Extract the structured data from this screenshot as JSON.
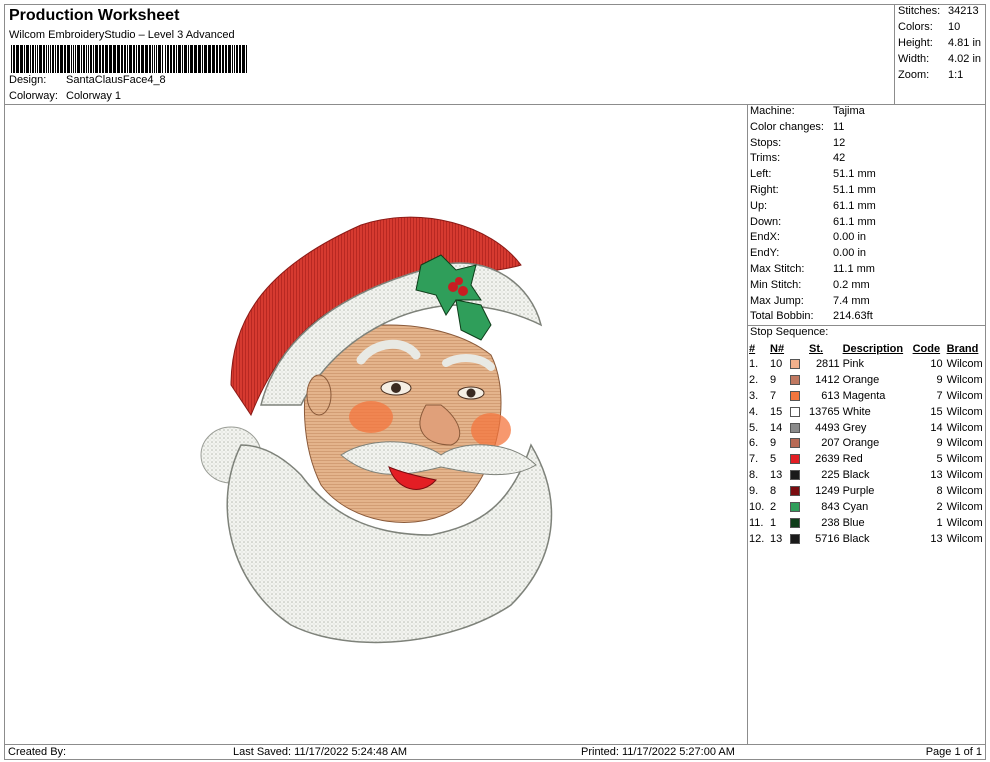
{
  "header": {
    "title": "Production Worksheet",
    "subtitle": "Wilcom EmbroideryStudio – Level 3 Advanced",
    "design_label": "Design:",
    "design_value": "SantaClausFace4_8",
    "colorway_label": "Colorway:",
    "colorway_value": "Colorway 1"
  },
  "stats": [
    {
      "label": "Stitches:",
      "value": "34213"
    },
    {
      "label": "Colors:",
      "value": "10"
    },
    {
      "label": "Height:",
      "value": "4.81 in"
    },
    {
      "label": "Width:",
      "value": "4.02 in"
    },
    {
      "label": "Zoom:",
      "value": "1:1"
    }
  ],
  "machine_info": [
    {
      "label": "Machine:",
      "value": "Tajima"
    },
    {
      "label": "Color changes:",
      "value": "11"
    },
    {
      "label": "Stops:",
      "value": "12"
    },
    {
      "label": "Trims:",
      "value": "42"
    },
    {
      "label": "Left:",
      "value": "51.1 mm"
    },
    {
      "label": "Right:",
      "value": "51.1 mm"
    },
    {
      "label": "Up:",
      "value": "61.1 mm"
    },
    {
      "label": "Down:",
      "value": "61.1 mm"
    },
    {
      "label": "EndX:",
      "value": "0.00 in"
    },
    {
      "label": "EndY:",
      "value": "0.00 in"
    },
    {
      "label": "Max Stitch:",
      "value": "11.1 mm"
    },
    {
      "label": "Min Stitch:",
      "value": "0.2 mm"
    },
    {
      "label": "Max Jump:",
      "value": "7.4 mm"
    },
    {
      "label": "Total Bobbin:",
      "value": "214.63ft"
    }
  ],
  "stop_sequence": {
    "title": "Stop Sequence:",
    "headers": {
      "idx": "#",
      "n": "N#",
      "st": "St.",
      "desc": "Description",
      "code": "Code",
      "brand": "Brand"
    },
    "rows": [
      {
        "idx": "1.",
        "n": "10",
        "color": "#f2b08c",
        "st": "2811",
        "desc": "Pink",
        "code": "10",
        "brand": "Wilcom"
      },
      {
        "idx": "2.",
        "n": "9",
        "color": "#c07860",
        "st": "1412",
        "desc": "Orange",
        "code": "9",
        "brand": "Wilcom"
      },
      {
        "idx": "3.",
        "n": "7",
        "color": "#f4763e",
        "st": "613",
        "desc": "Magenta",
        "code": "7",
        "brand": "Wilcom"
      },
      {
        "idx": "4.",
        "n": "15",
        "color": "#ffffff",
        "st": "13765",
        "desc": "White",
        "code": "15",
        "brand": "Wilcom"
      },
      {
        "idx": "5.",
        "n": "14",
        "color": "#8a8a8a",
        "st": "4493",
        "desc": "Grey",
        "code": "14",
        "brand": "Wilcom"
      },
      {
        "idx": "6.",
        "n": "9",
        "color": "#b86a55",
        "st": "207",
        "desc": "Orange",
        "code": "9",
        "brand": "Wilcom"
      },
      {
        "idx": "7.",
        "n": "5",
        "color": "#e31e24",
        "st": "2639",
        "desc": "Red",
        "code": "5",
        "brand": "Wilcom"
      },
      {
        "idx": "8.",
        "n": "13",
        "color": "#1a1a1a",
        "st": "225",
        "desc": "Black",
        "code": "13",
        "brand": "Wilcom"
      },
      {
        "idx": "9.",
        "n": "8",
        "color": "#7a0c10",
        "st": "1249",
        "desc": "Purple",
        "code": "8",
        "brand": "Wilcom"
      },
      {
        "idx": "10.",
        "n": "2",
        "color": "#2f9e5a",
        "st": "843",
        "desc": "Cyan",
        "code": "2",
        "brand": "Wilcom"
      },
      {
        "idx": "11.",
        "n": "1",
        "color": "#0f3d1a",
        "st": "238",
        "desc": "Blue",
        "code": "1",
        "brand": "Wilcom"
      },
      {
        "idx": "12.",
        "n": "13",
        "color": "#1a1a1a",
        "st": "5716",
        "desc": "Black",
        "code": "13",
        "brand": "Wilcom"
      }
    ]
  },
  "footer": {
    "created_by": "Created By:",
    "last_saved": "Last Saved: 11/17/2022 5:24:48 AM",
    "printed": "Printed: 11/17/2022 5:27:00 AM",
    "page": "Page 1 of 1"
  }
}
